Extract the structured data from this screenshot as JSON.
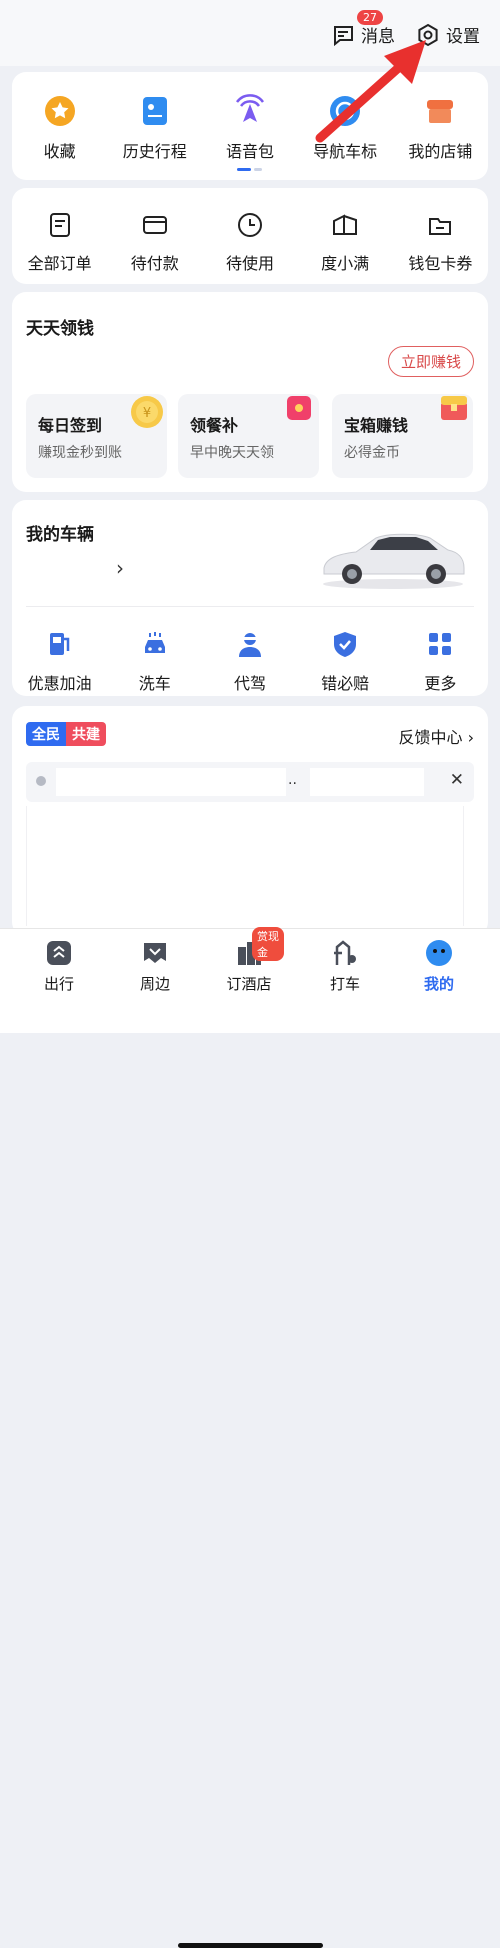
{
  "header": {
    "messages_label": "消息",
    "messages_count": "27",
    "settings_label": "设置"
  },
  "quick_menu": [
    {
      "label": "收藏",
      "icon": "star-icon"
    },
    {
      "label": "历史行程",
      "icon": "history-icon"
    },
    {
      "label": "语音包",
      "icon": "voice-icon"
    },
    {
      "label": "导航车标",
      "icon": "car-marker-icon"
    },
    {
      "label": "我的店铺",
      "icon": "shop-icon"
    }
  ],
  "orders": [
    {
      "label": "全部订单",
      "icon": "order-icon"
    },
    {
      "label": "待付款",
      "icon": "card-icon"
    },
    {
      "label": "待使用",
      "icon": "clock-icon"
    },
    {
      "label": "度小满",
      "icon": "wallet-icon"
    },
    {
      "label": "钱包卡券",
      "icon": "purse-icon"
    }
  ],
  "daily": {
    "title": "天天领钱",
    "button": "立即赚钱",
    "tasks": [
      {
        "title": "每日签到",
        "sub": "赚现金秒到账"
      },
      {
        "title": "领餐补",
        "sub": "早中晚天天领"
      },
      {
        "title": "宝箱赚钱",
        "sub": "必得金币"
      }
    ]
  },
  "vehicle": {
    "title": "我的车辆",
    "chevron": "›",
    "services": [
      {
        "label": "优惠加油",
        "icon": "fuel-icon"
      },
      {
        "label": "洗车",
        "icon": "car-wash-icon"
      },
      {
        "label": "代驾",
        "icon": "driver-icon"
      },
      {
        "label": "错必赔",
        "icon": "shield-icon"
      },
      {
        "label": "更多",
        "icon": "grid-icon"
      }
    ]
  },
  "community": {
    "tag_left": "全民",
    "tag_right": "共建",
    "feedback": "反馈中心 ›",
    "close": "✕",
    "dots": ".."
  },
  "tabbar": [
    {
      "label": "出行",
      "icon": "travel-icon"
    },
    {
      "label": "周边",
      "icon": "nearby-icon"
    },
    {
      "label": "订酒店",
      "icon": "hotel-icon",
      "badge": "赏现金"
    },
    {
      "label": "打车",
      "icon": "taxi-icon"
    },
    {
      "label": "我的",
      "icon": "profile-icon"
    }
  ],
  "colors": {
    "accent": "#2f6bf0",
    "red": "#e84545",
    "arrow": "#e8302e"
  }
}
